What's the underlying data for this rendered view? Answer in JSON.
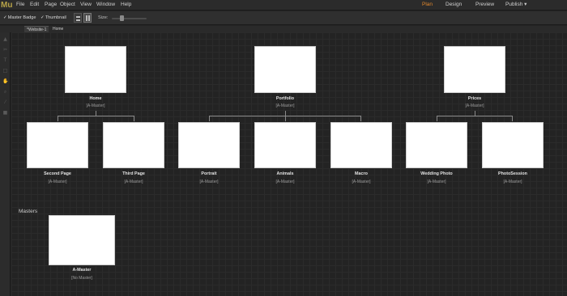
{
  "app": {
    "logo": "Mu",
    "menu": [
      "File",
      "Edit",
      "Page",
      "Object",
      "View",
      "Window",
      "Help"
    ],
    "modes": [
      "Plan",
      "Design",
      "Preview",
      "Publish ▾"
    ],
    "active_mode": "Plan"
  },
  "toolbar": {
    "master_badge": "Master Badge",
    "thumbnail": "Thumbnail",
    "size_label": "Size:"
  },
  "tabs": [
    "*Website-1",
    "Home"
  ],
  "sitemap": {
    "level1": [
      {
        "name": "Home",
        "master": "[A-Master]"
      },
      {
        "name": "Portfolio",
        "master": "[A-Master]"
      },
      {
        "name": "Prices",
        "master": "[A-Master]"
      }
    ],
    "level2": [
      {
        "name": "Second Page",
        "master": "[A-Master]"
      },
      {
        "name": "Third Page",
        "master": "[A-Master]"
      },
      {
        "name": "Portrait",
        "master": "[A-Master]"
      },
      {
        "name": "Animals",
        "master": "[A-Master]"
      },
      {
        "name": "Macro",
        "master": "[A-Master]"
      },
      {
        "name": "Wedding Photo",
        "master": "[A-Master]"
      },
      {
        "name": "PhotoSession",
        "master": "[A-Master]"
      }
    ]
  },
  "masters": {
    "label": "Masters",
    "items": [
      {
        "name": "A-Master",
        "master": "[No Master]"
      }
    ]
  }
}
